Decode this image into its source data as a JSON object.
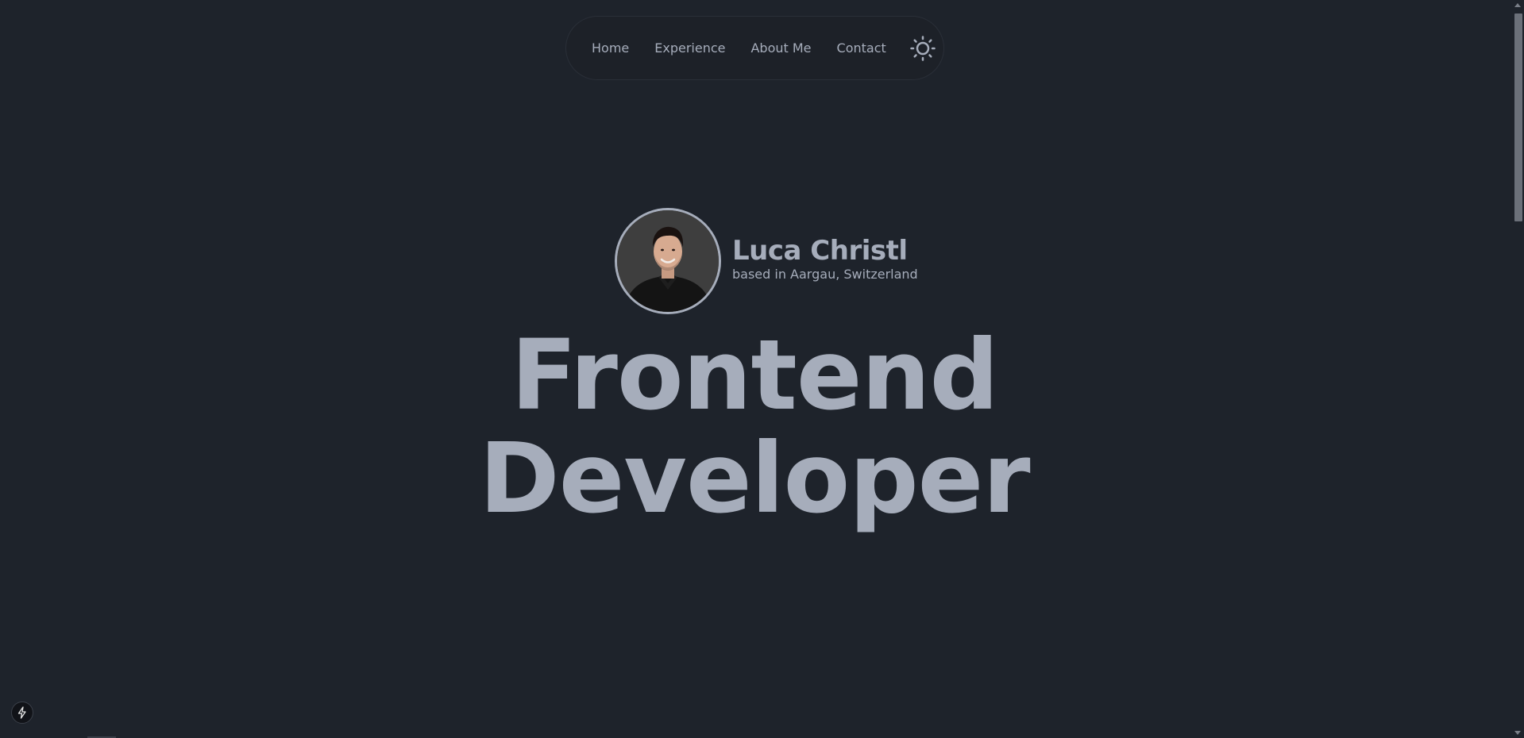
{
  "nav": {
    "items": [
      {
        "label": "Home"
      },
      {
        "label": "Experience"
      },
      {
        "label": "About Me"
      },
      {
        "label": "Contact"
      }
    ],
    "theme_toggle_icon": "sun-icon"
  },
  "profile": {
    "name": "Luca Christl",
    "location": "based in Aargau, Switzerland"
  },
  "hero": {
    "line1": "Frontend",
    "line2": "Developer"
  },
  "colors": {
    "background": "#1e232b",
    "text": "#a6adbb"
  },
  "badge": {
    "icon": "lightning-icon"
  }
}
